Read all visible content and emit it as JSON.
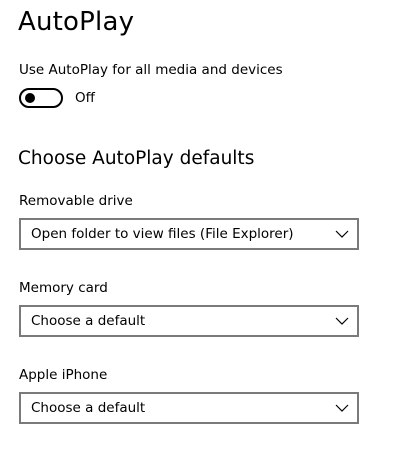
{
  "page": {
    "title": "AutoPlay"
  },
  "autoplay_toggle": {
    "label": "Use AutoPlay for all media and devices",
    "state": "Off",
    "on": false
  },
  "defaults_section": {
    "heading": "Choose AutoPlay defaults",
    "items": [
      {
        "label": "Removable drive",
        "value": "Open folder to view files (File Explorer)"
      },
      {
        "label": "Memory card",
        "value": "Choose a default"
      },
      {
        "label": "Apple iPhone",
        "value": "Choose a default"
      }
    ]
  },
  "icons": {
    "dropdown": "chevron-down-icon"
  },
  "colors": {
    "text": "#000000",
    "dropdown_border": "#7a7a7a",
    "background": "#ffffff"
  }
}
